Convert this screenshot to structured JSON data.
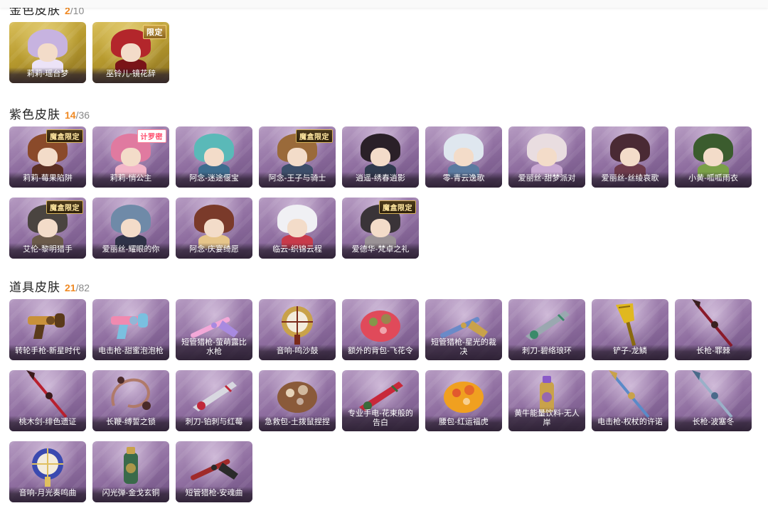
{
  "sections": [
    {
      "title": "金色皮肤",
      "owned": "2",
      "total": "/10",
      "theme": "gold",
      "items": [
        {
          "label": "莉莉-瑶台梦",
          "hair": "#c7b3e0",
          "body": "#ece3f7",
          "badge": ""
        },
        {
          "label": "巫铃儿-镜花辞",
          "hair": "#b3262b",
          "body": "#7a1418",
          "badge": "限定",
          "badge_type": "limited"
        }
      ]
    },
    {
      "title": "紫色皮肤",
      "owned": "14",
      "total": "/36",
      "theme": "purple",
      "items": [
        {
          "label": "莉莉-莓果陷阱",
          "hair": "#8a4a2a",
          "body": "#5b2f23",
          "badge": "魔盒限定",
          "badge_type": "box"
        },
        {
          "label": "莉莉-悄公主",
          "hair": "#e07aa0",
          "body": "#f2b5c8",
          "badge": "计罗密",
          "badge_type": "collab"
        },
        {
          "label": "阿念-迷途偃宝",
          "hair": "#5ab9b8",
          "body": "#3d6c8e",
          "badge": ""
        },
        {
          "label": "阿念-王子与骑士",
          "hair": "#9a6a3a",
          "body": "#3c4e6a",
          "badge": "魔盒限定",
          "badge_type": "box"
        },
        {
          "label": "逍遥-绣春逍影",
          "hair": "#2a2028",
          "body": "#2f3a4e",
          "badge": ""
        },
        {
          "label": "零-青云逸歌",
          "hair": "#dfe7ef",
          "body": "#5a7aa0",
          "badge": ""
        },
        {
          "label": "爱丽丝-甜梦派对",
          "hair": "#e9dde0",
          "body": "#c9a9d3",
          "badge": ""
        },
        {
          "label": "爱丽丝-丝绫哀歌",
          "hair": "#4a2a34",
          "body": "#6d3a4a",
          "badge": ""
        },
        {
          "label": "小黄-呱呱雨衣",
          "hair": "#3b5c2e",
          "body": "#7aa048",
          "badge": ""
        },
        {
          "label": "艾伦-黎明猎手",
          "hair": "#4a4440",
          "body": "#6b5a4a",
          "badge": "魔盒限定",
          "badge_type": "box"
        },
        {
          "label": "爱丽丝-耀眼的你",
          "hair": "#6f8aa8",
          "body": "#2f3348",
          "badge": ""
        },
        {
          "label": "阿念-庆宴绮愿",
          "hair": "#7a3a2a",
          "body": "#e6c58a",
          "badge": ""
        },
        {
          "label": "临云-织锦云程",
          "hair": "#f0f0f4",
          "body": "#c83a4a",
          "badge": ""
        },
        {
          "label": "爱德华-梵卓之礼",
          "hair": "#3a3438",
          "body": "#9a9296",
          "badge": "魔盒限定",
          "badge_type": "box"
        }
      ]
    },
    {
      "title": "道具皮肤",
      "owned": "21",
      "total": "/82",
      "theme": "purple",
      "items": [
        {
          "label": "转轮手枪-新星时代",
          "color": "#c8913a",
          "accent": "#5a3a1a",
          "shape": "gun"
        },
        {
          "label": "电击枪-甜蜜泡泡枪",
          "color": "#f08ab0",
          "accent": "#7ac0e0",
          "shape": "gun"
        },
        {
          "label": "短管猎枪-萤萌露比水枪",
          "color": "#f3a8d8",
          "accent": "#a88ae0",
          "shape": "rifle"
        },
        {
          "label": "音响-鸣沙鼓",
          "color": "#c9a24a",
          "accent": "#7a2a1a",
          "shape": "drum"
        },
        {
          "label": "额外的背包-飞花令",
          "color": "#e04a5a",
          "accent": "#7aa048",
          "shape": "bag"
        },
        {
          "label": "短管猎枪-星光的裁决",
          "color": "#6a8ac8",
          "accent": "#c9a24a",
          "shape": "rifle"
        },
        {
          "label": "刺刀-碧络琅环",
          "color": "#9aa8b0",
          "accent": "#3a8a6a",
          "shape": "blade"
        },
        {
          "label": "铲子-龙鳞",
          "color": "#e0b820",
          "accent": "#8a6a10",
          "shape": "shovel"
        },
        {
          "label": "长枪-罪棘",
          "color": "#8a1a2a",
          "accent": "#3a2020",
          "shape": "spear"
        },
        {
          "label": "桃木剑-绯色遗证",
          "color": "#b8202e",
          "accent": "#3a1a1a",
          "shape": "spear"
        },
        {
          "label": "长鞭-缚誓之锁",
          "color": "#b07a6a",
          "accent": "#4a2a2a",
          "shape": "whip"
        },
        {
          "label": "刺刀-铂刺与红莓",
          "color": "#d8d8e0",
          "accent": "#c0283a",
          "shape": "blade"
        },
        {
          "label": "急救包-土拨鼠捏捏",
          "color": "#8a5a3a",
          "accent": "#f0e0c8",
          "shape": "bag"
        },
        {
          "label": "专业手电-花束般的告白",
          "color": "#c8283a",
          "accent": "#3a6a3a",
          "shape": "blade"
        },
        {
          "label": "腰包-红运福虎",
          "color": "#f0a020",
          "accent": "#e05030",
          "shape": "bag"
        },
        {
          "label": "黄牛能量饮料-无人岸",
          "color": "#c9a24a",
          "accent": "#8a5ac8",
          "shape": "bottle"
        },
        {
          "label": "电击枪-权杖的许诺",
          "color": "#5a8ac8",
          "accent": "#c9a24a",
          "shape": "spear"
        },
        {
          "label": "长枪-波塞冬",
          "color": "#9ab0c8",
          "accent": "#4a6a8a",
          "shape": "spear"
        },
        {
          "label": "音响-月光奏鸣曲",
          "color": "#3a4ab0",
          "accent": "#e0c060",
          "shape": "drum"
        },
        {
          "label": "闪光弹-金戈玄铜",
          "color": "#3a6a4a",
          "accent": "#c9a24a",
          "shape": "bottle"
        },
        {
          "label": "短管猎枪-安魂曲",
          "color": "#a02a2a",
          "accent": "#2a2a2a",
          "shape": "rifle"
        }
      ]
    }
  ]
}
